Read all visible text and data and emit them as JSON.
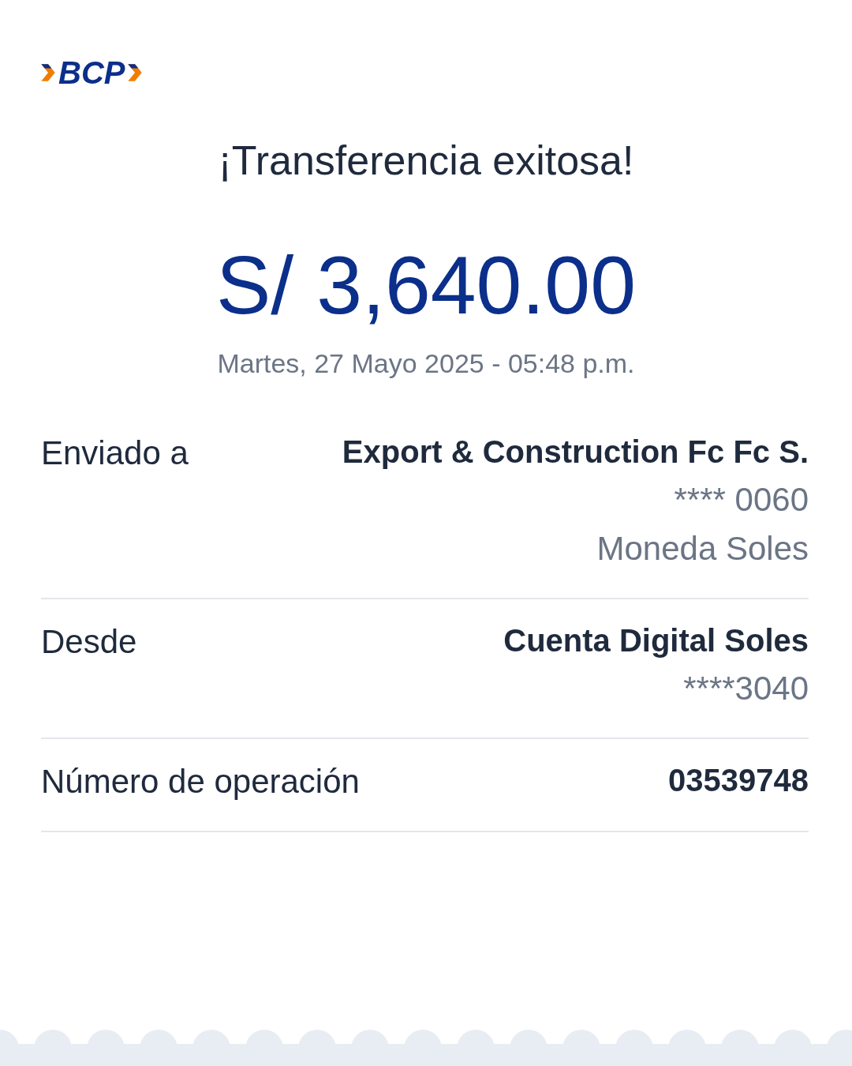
{
  "logo": {
    "text": "BCP"
  },
  "title": "¡Transferencia exitosa!",
  "amount": "S/ 3,640.00",
  "datetime": "Martes, 27 Mayo 2025 - 05:48 p.m.",
  "details": [
    {
      "label": "Enviado a",
      "lines": [
        "Export & Construction Fc Fc S.",
        "**** 0060",
        "Moneda Soles"
      ]
    },
    {
      "label": "Desde",
      "lines": [
        "Cuenta Digital Soles",
        "****3040"
      ]
    },
    {
      "label": "Número de operación",
      "lines": [
        "03539748"
      ]
    }
  ]
}
